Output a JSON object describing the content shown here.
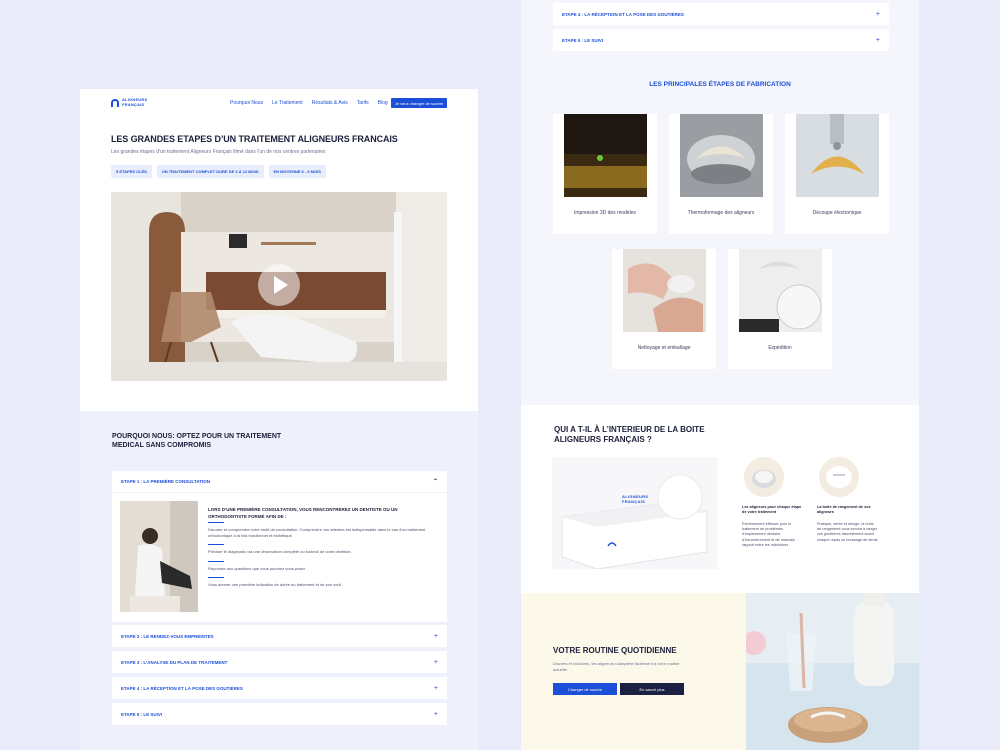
{
  "left": {
    "nav": {
      "logo_text": "ALIGNEURS FRANÇAIS",
      "links": [
        "Pourquoi Nous",
        "Le Traitement",
        "Résultats & Avis",
        "Tarifs",
        "Blog"
      ],
      "cta": "Je veux changer de sourire"
    },
    "hero": {
      "title": "LES GRANDES ETAPES D’UN TRAITEMENT ALIGNEURS FRANCAIS",
      "subtitle": "Les grandes étapes d'un traitement Aligneurs Français filmé dans l'un de nos centres partenaires",
      "pills": [
        "5 ETAPES CLÉS",
        "UN TRAITEMENT COMPLET DURE DE 3 À 12 MOIS",
        "EN MOYENNE 6 - 9 MOIS"
      ]
    },
    "why": {
      "title": "POURQUOI NOUS: OPTEZ POUR UN TRAITEMENT MEDICAL SANS COMPROMIS",
      "open_step": {
        "label": "ETAPE 1 : LA PREMIÈRE CONSULTATION",
        "lead": "LORS D’UNE PREMIÈRE CONSULTATION, VOUS RENCONTREREZ UN DENTISTE OU UN ORTHODONTISTE FORMÉ AFIN DE :",
        "points": [
          "Discuter et comprendre votre motif de consultation. Comprendre vos attentes est indispensable dans le cas d'un traitement orthodontique à la fois fonctionnel et esthétique.",
          "Préciser le diagnostic via une observation complète ou fouteuil de votre dentition.",
          "Répondre aux questions que vous pourriez vous poser.",
          "Vous donner une première indication de durée du traitement et de son coût."
        ]
      },
      "steps": [
        "ETAPE 2 : LE RENDEZ-VOUS EMPREINTES",
        "ETAPE 3 : L'ANALYSE DU PLAN DE TRAITEMENT",
        "ETAPE 4 : LA RÉCEPTION ET LA POSE DES GOUTIÈRES",
        "ETAPE 5 : LE SUIVI"
      ]
    }
  },
  "right": {
    "top_steps": [
      "ETAPE 4 : LA RÉCEPTION ET LA POSE DES GOUTIÈRES",
      "ETAPE 5 : LE SUIVI"
    ],
    "fabrication": {
      "title": "LES PRINCIPALES ÉTAPES DE FABRICATION",
      "cards": [
        "Impression 3D des modèles",
        "Thermoformage des aligneurs",
        "Découpe électronique",
        "Nettoyage et emballage",
        "Expédition"
      ]
    },
    "box": {
      "title": "QUI A T-IL À L’INTERIEUR DE LA BOITE ALIGNEURS FRANÇAIS ?",
      "brand": "ALIGNEURS FRANÇAIS",
      "features": [
        {
          "title": "Les aligneurs pour chaque étape de votre traitement",
          "desc": "Extrêmement efficace pour le traitement de problèmes d'espacement dentaire, d'encombrement et de mauvais rapport entre les mâchoires"
        },
        {
          "title": "La boîte de rangement de vos aligneurs",
          "desc": "Pratique, sérée et design, la boîte de rangement vous servira à ranger vos gouttières discrètement avant chaque repas ou brossage de dents."
        }
      ]
    },
    "routine": {
      "title": "VOTRE ROUTINE QUOTIDIENNE",
      "desc": "Discrets et indolores, les aligneurs s'adaptent facilement à votre routine actuelle.",
      "btn_primary": "Changer de sourire",
      "btn_secondary": "En savoir plus"
    }
  }
}
